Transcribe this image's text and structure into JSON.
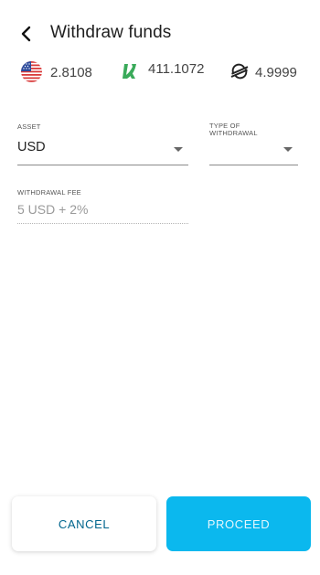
{
  "header": {
    "title": "Withdraw funds"
  },
  "balances": [
    {
      "icon": "us-flag-icon",
      "amount": "2.8108"
    },
    {
      "icon": "green-x-logo-icon",
      "amount": "411.1072"
    },
    {
      "icon": "stellar-icon",
      "amount": "4.9999"
    }
  ],
  "form": {
    "asset": {
      "label": "ASSET",
      "value": "USD"
    },
    "type": {
      "label_line1": "TYPE OF",
      "label_line2": "WITHDRAWAL",
      "value": ""
    },
    "fee": {
      "label": "WITHDRAWAL FEE",
      "value": "5 USD + 2%"
    }
  },
  "actions": {
    "cancel": "CANCEL",
    "proceed": "PROCEED"
  },
  "colors": {
    "accent": "#0bb8ee",
    "cancel_text": "#00658d",
    "brand_green": "#3aaa5a"
  }
}
